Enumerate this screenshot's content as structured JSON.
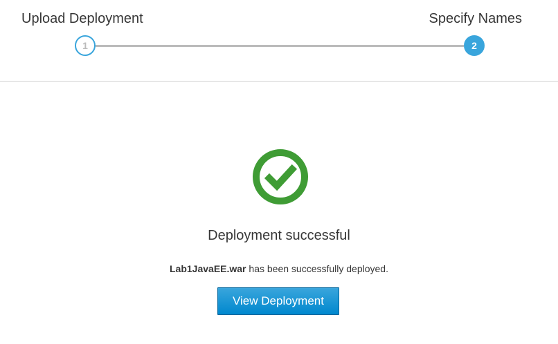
{
  "wizard": {
    "steps": [
      {
        "number": "1",
        "title": "Upload Deployment"
      },
      {
        "number": "2",
        "title": "Specify Names"
      }
    ],
    "active_step": 2
  },
  "result": {
    "icon": "check-circle-icon",
    "title": "Deployment successful",
    "filename": "Lab1JavaEE.war",
    "message_suffix": " has been successfully deployed.",
    "button_label": "View Deployment"
  },
  "colors": {
    "accent": "#39a5dc",
    "success": "#3f9c35",
    "button": "#0088ce"
  }
}
